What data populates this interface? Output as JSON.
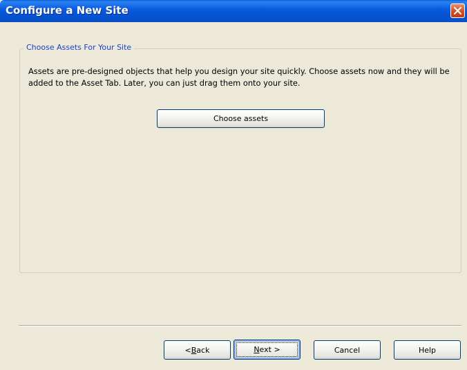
{
  "window": {
    "title": "Configure a New Site"
  },
  "group": {
    "legend": "Choose Assets For Your Site",
    "description": "Assets are pre-designed objects that help you design your site quickly. Choose assets now and they will be added to the Asset Tab. Later, you can just drag them onto your site.",
    "choose_button": "Choose assets"
  },
  "footer": {
    "back": {
      "prefix": "< ",
      "mnemonic": "B",
      "rest": "ack"
    },
    "next": {
      "mnemonic": "N",
      "rest": "ext >"
    },
    "cancel": "Cancel",
    "help": "Help"
  },
  "colors": {
    "titlebar": "#0553d4",
    "face": "#ece9d8",
    "legend_text": "#1c3ec4",
    "close_button": "#d24b1f"
  },
  "icons": {
    "close": "close-icon"
  }
}
